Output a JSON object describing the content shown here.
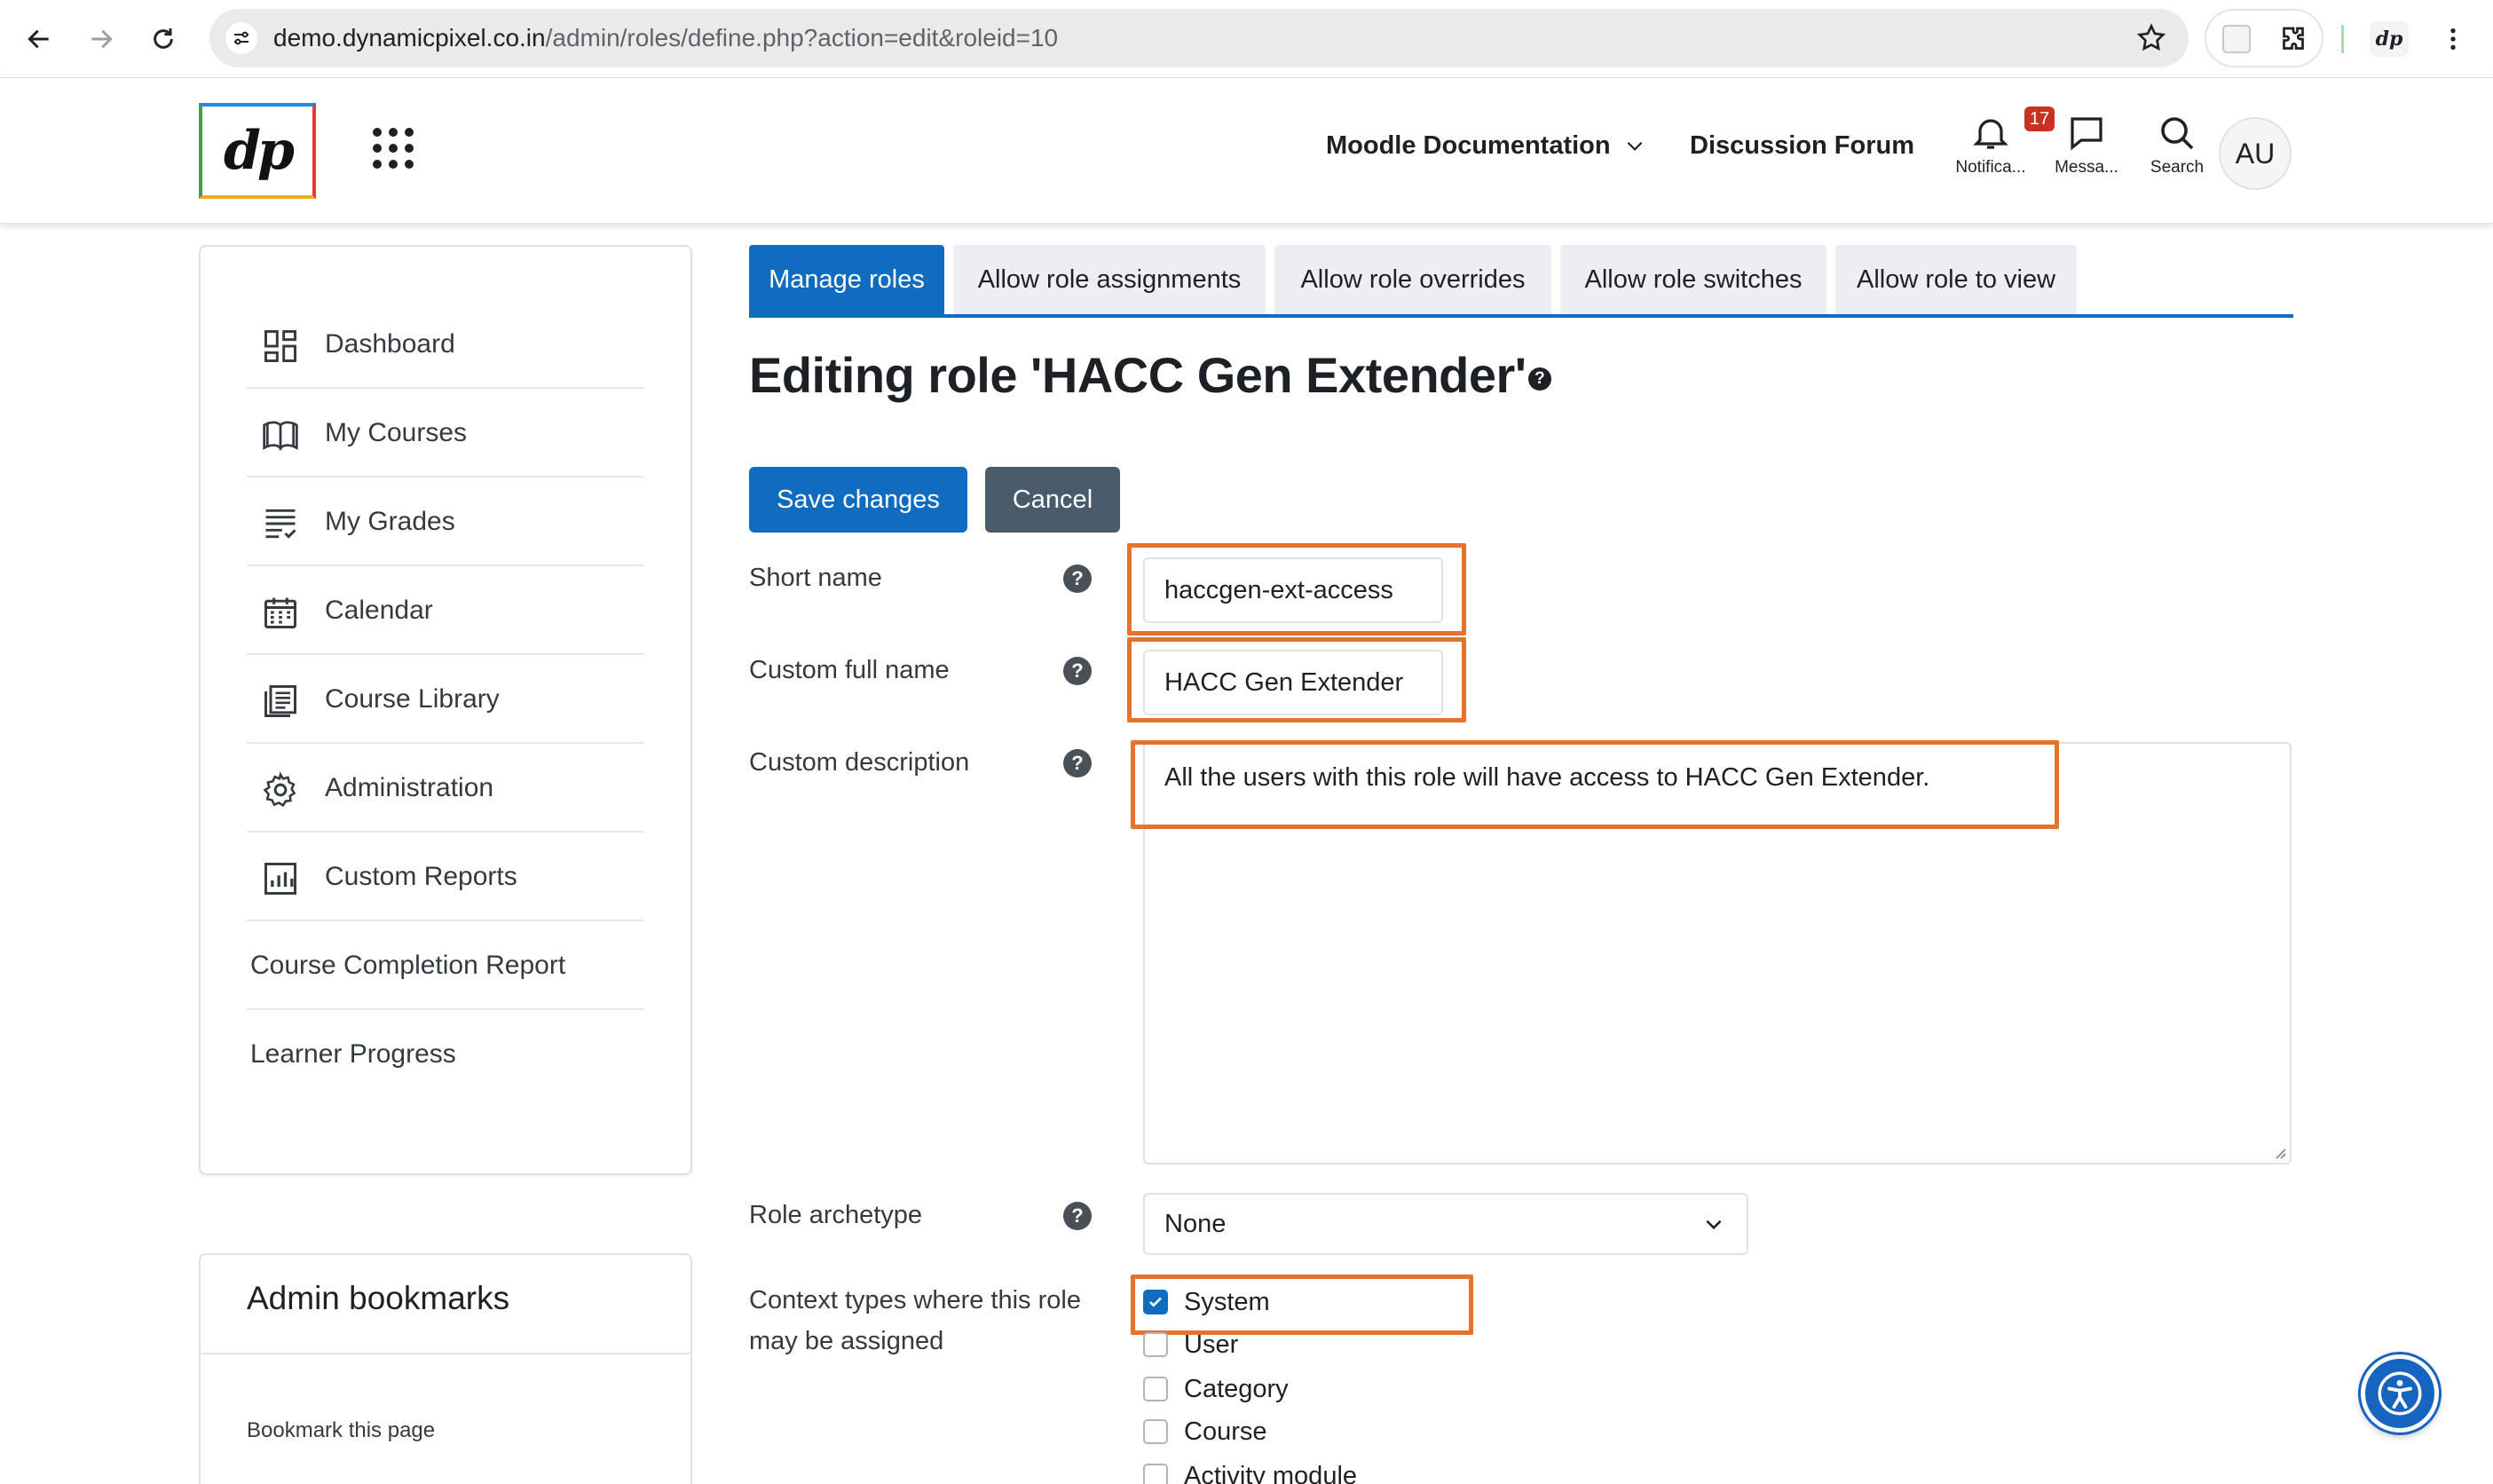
{
  "browser": {
    "url_host": "demo.dynamicpixel.co.in",
    "url_path": "/admin/roles/define.php?action=edit&roleid=10",
    "profile_label": "dp"
  },
  "header": {
    "logo_text": "dp",
    "nav": {
      "documentation": "Moodle Documentation",
      "forum": "Discussion Forum"
    },
    "notifications": {
      "label": "Notifica...",
      "count": "17"
    },
    "messages": {
      "label": "Messa..."
    },
    "search": {
      "label": "Search"
    },
    "avatar": "AU"
  },
  "sidebar": {
    "items": [
      {
        "label": "Dashboard",
        "icon": "dashboard-icon"
      },
      {
        "label": "My Courses",
        "icon": "book-icon"
      },
      {
        "label": "My Grades",
        "icon": "grades-icon"
      },
      {
        "label": "Calendar",
        "icon": "calendar-icon"
      },
      {
        "label": "Course Library",
        "icon": "library-icon"
      },
      {
        "label": "Administration",
        "icon": "gear-icon"
      },
      {
        "label": "Custom Reports",
        "icon": "report-icon"
      },
      {
        "label": "Course Completion Report"
      },
      {
        "label": "Learner Progress"
      }
    ]
  },
  "bookmarks": {
    "title": "Admin bookmarks",
    "link": "Bookmark this page"
  },
  "tabs": [
    {
      "label": "Manage roles",
      "active": true
    },
    {
      "label": "Allow role assignments"
    },
    {
      "label": "Allow role overrides"
    },
    {
      "label": "Allow role switches"
    },
    {
      "label": "Allow role to view"
    }
  ],
  "page": {
    "title": "Editing role 'HACC Gen Extender'",
    "save_label": "Save changes",
    "cancel_label": "Cancel"
  },
  "form": {
    "short_name": {
      "label": "Short name",
      "value": "haccgen-ext-access"
    },
    "full_name": {
      "label": "Custom full name",
      "value": "HACC Gen Extender"
    },
    "description": {
      "label": "Custom description",
      "value": "All the users with this role will have access to HACC Gen Extender."
    },
    "archetype": {
      "label": "Role archetype",
      "value": "None"
    },
    "contexts": {
      "label_line1": "Context types where this role",
      "label_line2": "may be assigned",
      "options": [
        {
          "label": "System",
          "checked": true
        },
        {
          "label": "User",
          "checked": false
        },
        {
          "label": "Category",
          "checked": false
        },
        {
          "label": "Course",
          "checked": false
        },
        {
          "label": "Activity module",
          "checked": false
        }
      ]
    }
  },
  "colors": {
    "primary": "#0f6cbf",
    "secondary": "#495a6b",
    "highlight": "#e5732c",
    "badge": "#ca3120"
  }
}
